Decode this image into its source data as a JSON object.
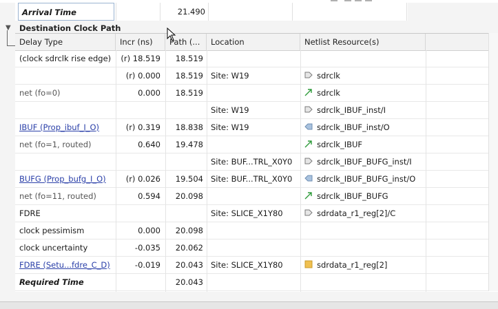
{
  "arrival": {
    "label": "Arrival Time",
    "path": "21.490"
  },
  "section": {
    "title": "Destination Clock Path",
    "expanded_icon": "chevron-down-icon"
  },
  "columns": {
    "delay_type": "Delay Type",
    "incr": "Incr (ns)",
    "path": "Path (...",
    "location": "Location",
    "netlist": "Netlist Resource(s)"
  },
  "rows": [
    {
      "delay_type": "(clock sdrclk rise edge)",
      "incr": "(r) 18.519",
      "path": "18.519",
      "location": "",
      "netlist": "",
      "icon": "",
      "style": "normal"
    },
    {
      "delay_type": "",
      "incr": "(r) 0.000",
      "path": "18.519",
      "location": "Site: W19",
      "netlist": "sdrclk",
      "icon": "port",
      "style": "normal"
    },
    {
      "delay_type": "net (fo=0)",
      "incr": "0.000",
      "path": "18.519",
      "location": "",
      "netlist": "sdrclk",
      "icon": "net",
      "style": "muted"
    },
    {
      "delay_type": "",
      "incr": "",
      "path": "",
      "location": "Site: W19",
      "netlist": "sdrclk_IBUF_inst/I",
      "icon": "port",
      "style": "normal"
    },
    {
      "delay_type": "IBUF (Prop_ibuf_I_O)",
      "incr": "(r) 0.319",
      "path": "18.838",
      "location": "Site: W19",
      "netlist": "sdrclk_IBUF_inst/O",
      "icon": "port-out",
      "style": "link"
    },
    {
      "delay_type": "net (fo=1, routed)",
      "incr": "0.640",
      "path": "19.478",
      "location": "",
      "netlist": "sdrclk_IBUF",
      "icon": "net",
      "style": "muted"
    },
    {
      "delay_type": "",
      "incr": "",
      "path": "",
      "location": "Site: BUF...TRL_X0Y0",
      "netlist": "sdrclk_IBUF_BUFG_inst/I",
      "icon": "port",
      "style": "normal"
    },
    {
      "delay_type": "BUFG (Prop_bufg_I_O)",
      "incr": "(r) 0.026",
      "path": "19.504",
      "location": "Site: BUF...TRL_X0Y0",
      "netlist": "sdrclk_IBUF_BUFG_inst/O",
      "icon": "port-out",
      "style": "link"
    },
    {
      "delay_type": "net (fo=11, routed)",
      "incr": "0.594",
      "path": "20.098",
      "location": "",
      "netlist": "sdrclk_IBUF_BUFG",
      "icon": "net",
      "style": "muted"
    },
    {
      "delay_type": "FDRE",
      "incr": "",
      "path": "",
      "location": "Site: SLICE_X1Y80",
      "netlist": "sdrdata_r1_reg[2]/C",
      "icon": "port",
      "style": "normal"
    },
    {
      "delay_type": "clock pessimism",
      "incr": "0.000",
      "path": "20.098",
      "location": "",
      "netlist": "",
      "icon": "",
      "style": "normal"
    },
    {
      "delay_type": "clock uncertainty",
      "incr": "-0.035",
      "path": "20.062",
      "location": "",
      "netlist": "",
      "icon": "",
      "style": "normal"
    },
    {
      "delay_type": "FDRE (Setu...fdre_C_D)",
      "incr": "-0.019",
      "path": "20.043",
      "location": "Site: SLICE_X1Y80",
      "netlist": "sdrdata_r1_reg[2]",
      "icon": "cell",
      "style": "link"
    },
    {
      "delay_type": "Required Time",
      "incr": "",
      "path": "20.043",
      "location": "",
      "netlist": "",
      "icon": "",
      "style": "bold"
    }
  ],
  "colors": {
    "link": "#2a3fa8",
    "net_icon": "#2e9b3a",
    "port_icon": "#7a7a7a",
    "port_out_icon": "#6f8fb3",
    "cell_icon": "#f0c050"
  }
}
